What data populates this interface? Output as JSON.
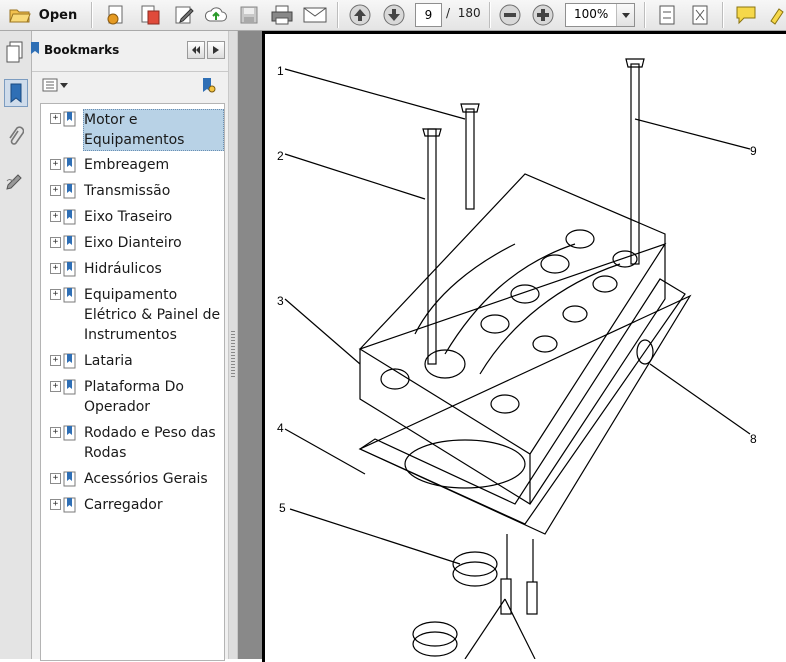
{
  "toolbar": {
    "open_label": "Open",
    "page_current": "9",
    "page_separator": "/",
    "page_total": "180",
    "zoom": "100%"
  },
  "panel": {
    "title": "Bookmarks"
  },
  "bookmarks": [
    {
      "label": "Motor e Equipamentos",
      "selected": true
    },
    {
      "label": "Embreagem"
    },
    {
      "label": "Transmissão"
    },
    {
      "label": "Eixo Traseiro"
    },
    {
      "label": "Eixo Dianteiro"
    },
    {
      "label": "Hidráulicos"
    },
    {
      "label": "Equipamento Elétrico & Painel de Instrumentos"
    },
    {
      "label": "Lataria"
    },
    {
      "label": "Plataforma Do Operador"
    },
    {
      "label": "Rodado e Peso das Rodas"
    },
    {
      "label": "Acessórios Gerais"
    },
    {
      "label": "Carregador"
    }
  ],
  "drawing": {
    "callouts": [
      "1",
      "2",
      "3",
      "4",
      "5",
      "8",
      "9"
    ]
  },
  "colors": {
    "selection": "#b8d2e6",
    "doc_background": "#898989",
    "toolbar": "#e4e4e4"
  }
}
